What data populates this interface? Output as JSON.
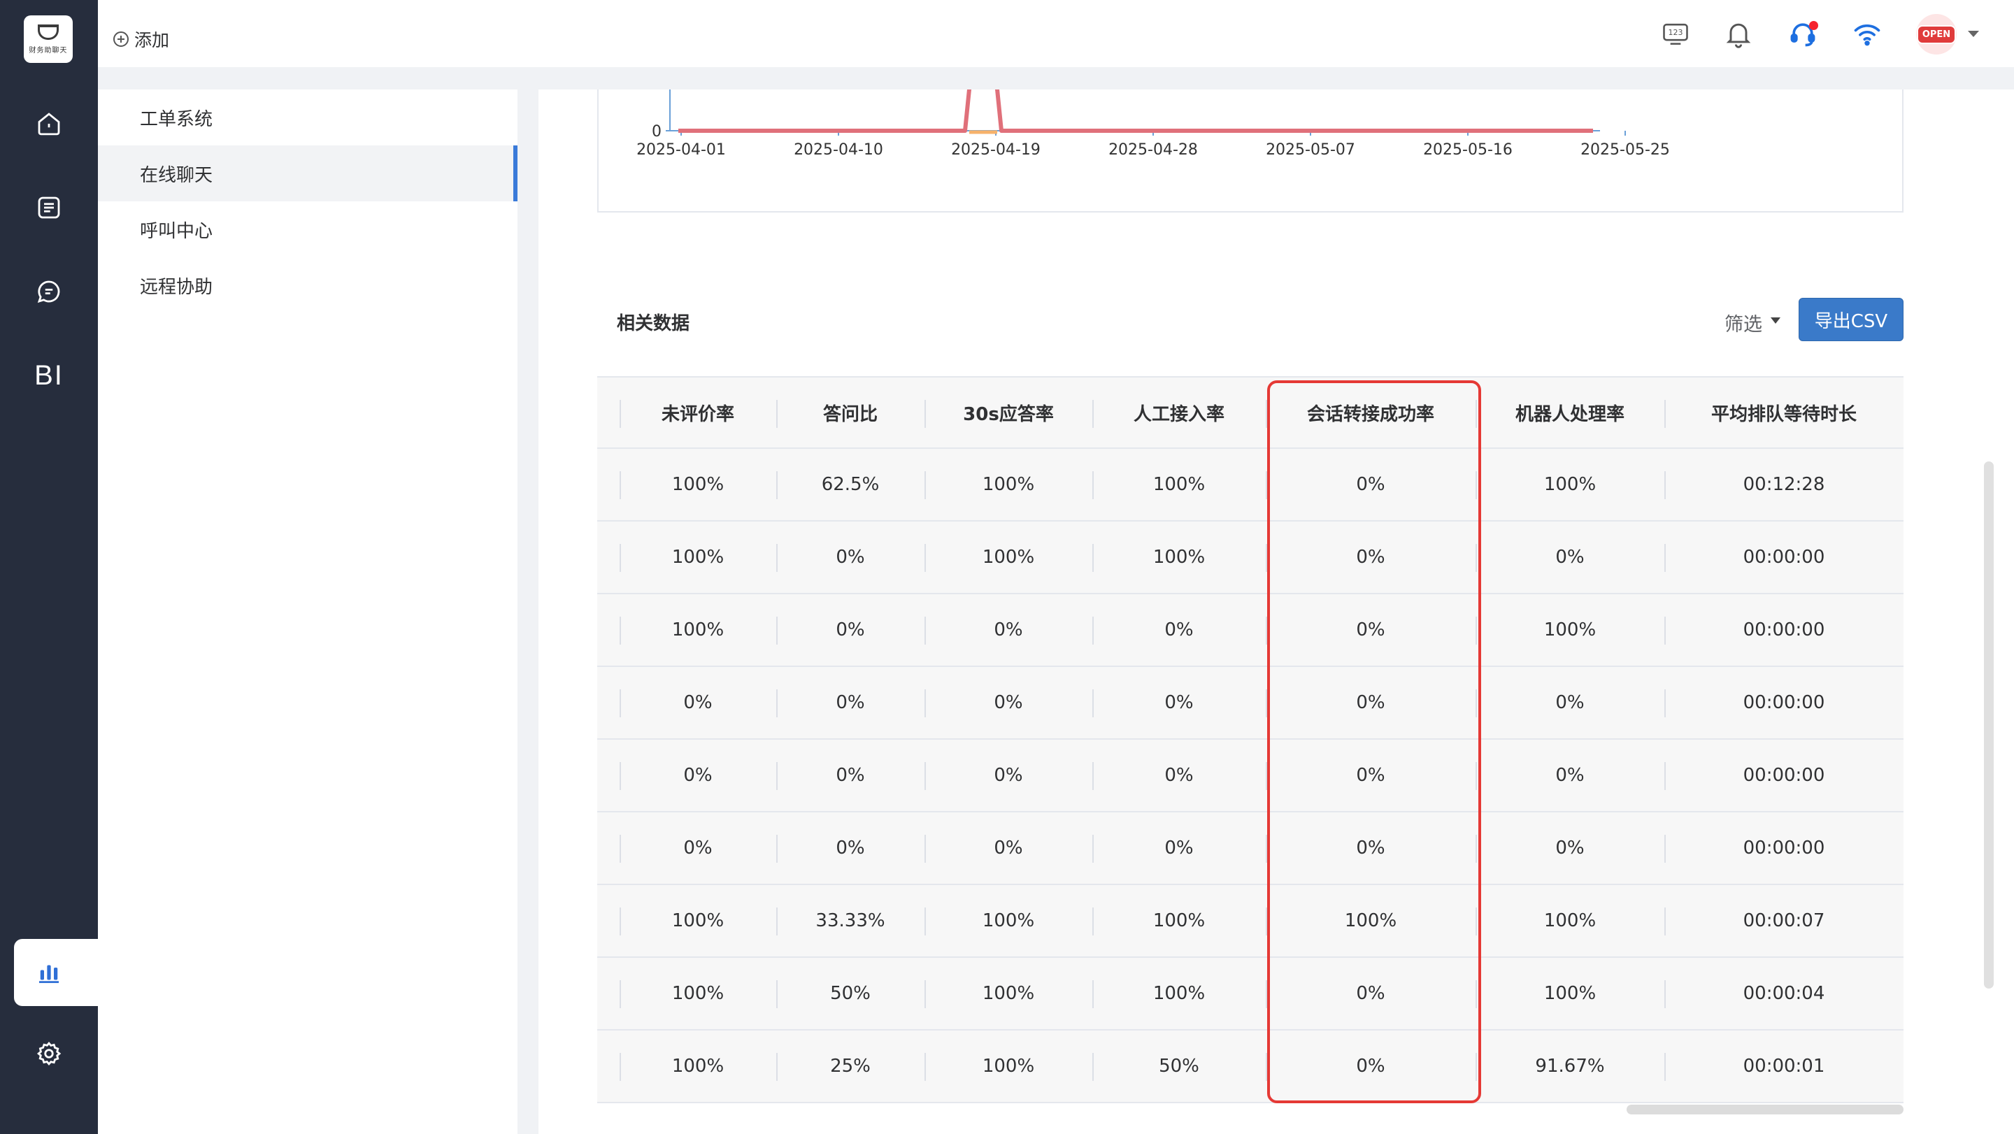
{
  "app": {
    "logo_text": "财务助聊天"
  },
  "topbar": {
    "add_label": "添加",
    "avatar_sign": "OPEN"
  },
  "nav": {
    "items": [
      {
        "name": "home-icon"
      },
      {
        "name": "document-icon"
      },
      {
        "name": "chat-icon"
      },
      {
        "name": "bi",
        "label": "BI"
      },
      {
        "name": "bar-chart-icon"
      },
      {
        "name": "gear-icon"
      }
    ]
  },
  "submenu": {
    "items": [
      {
        "label": "工单系统"
      },
      {
        "label": "在线聊天",
        "active": true
      },
      {
        "label": "呼叫中心"
      },
      {
        "label": "远程协助"
      }
    ]
  },
  "chart_data": {
    "type": "line",
    "x_ticks": [
      "2025-04-01",
      "2025-04-10",
      "2025-04-19",
      "2025-04-28",
      "2025-05-07",
      "2025-05-16",
      "2025-05-25"
    ],
    "y_ticks": [
      "0"
    ],
    "colors": {
      "series1": "#e0707a",
      "series2": "#f6b26b"
    }
  },
  "section": {
    "title": "相关数据",
    "filter_label": "筛选",
    "export_label": "导出CSV"
  },
  "table": {
    "columns": [
      "未评价率",
      "答问比",
      "30s应答率",
      "人工接入率",
      "会话转接成功率",
      "机器人处理率",
      "平均排队等待时长"
    ],
    "rows": [
      [
        "100%",
        "62.5%",
        "100%",
        "100%",
        "0%",
        "100%",
        "00:12:28"
      ],
      [
        "100%",
        "0%",
        "100%",
        "100%",
        "0%",
        "0%",
        "00:00:00"
      ],
      [
        "100%",
        "0%",
        "0%",
        "0%",
        "0%",
        "100%",
        "00:00:00"
      ],
      [
        "0%",
        "0%",
        "0%",
        "0%",
        "0%",
        "0%",
        "00:00:00"
      ],
      [
        "0%",
        "0%",
        "0%",
        "0%",
        "0%",
        "0%",
        "00:00:00"
      ],
      [
        "0%",
        "0%",
        "0%",
        "0%",
        "0%",
        "0%",
        "00:00:00"
      ],
      [
        "100%",
        "33.33%",
        "100%",
        "100%",
        "100%",
        "100%",
        "00:00:07"
      ],
      [
        "100%",
        "50%",
        "100%",
        "100%",
        "0%",
        "100%",
        "00:00:04"
      ],
      [
        "100%",
        "25%",
        "100%",
        "50%",
        "0%",
        "91.67%",
        "00:00:01"
      ]
    ]
  },
  "colors": {
    "accent": "#3a7ac9",
    "highlight": "#e53935",
    "nav_bg": "#262d3d"
  }
}
